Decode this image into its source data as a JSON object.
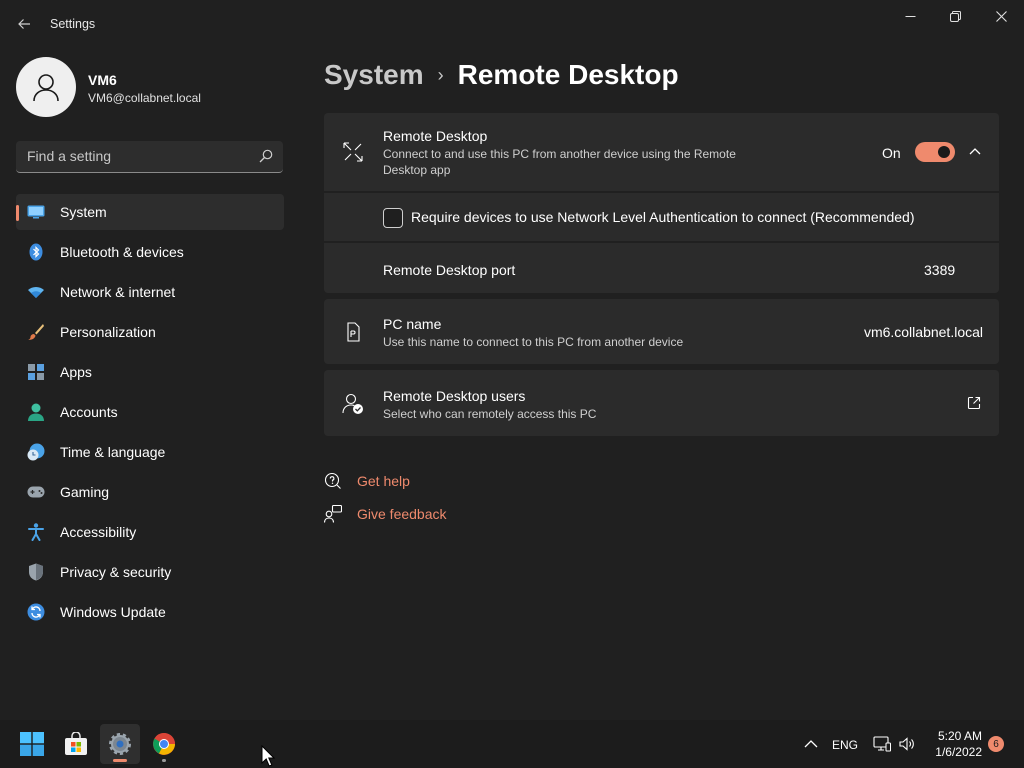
{
  "window": {
    "title": "Settings"
  },
  "user": {
    "name": "VM6",
    "email": "VM6@collabnet.local"
  },
  "search": {
    "placeholder": "Find a setting"
  },
  "nav": {
    "items": [
      {
        "label": "System",
        "icon": "system-icon",
        "active": true
      },
      {
        "label": "Bluetooth & devices",
        "icon": "bluetooth-icon"
      },
      {
        "label": "Network & internet",
        "icon": "wifi-icon"
      },
      {
        "label": "Personalization",
        "icon": "brush-icon"
      },
      {
        "label": "Apps",
        "icon": "apps-icon"
      },
      {
        "label": "Accounts",
        "icon": "accounts-icon"
      },
      {
        "label": "Time & language",
        "icon": "clock-globe-icon"
      },
      {
        "label": "Gaming",
        "icon": "gamepad-icon"
      },
      {
        "label": "Accessibility",
        "icon": "accessibility-icon"
      },
      {
        "label": "Privacy & security",
        "icon": "shield-icon"
      },
      {
        "label": "Windows Update",
        "icon": "update-icon"
      }
    ]
  },
  "breadcrumb": {
    "parent": "System",
    "current": "Remote Desktop"
  },
  "remote_desktop": {
    "title": "Remote Desktop",
    "description_line1": "Connect to and use this PC from another device using the Remote",
    "description_line2": "Desktop app",
    "toggle_label": "On",
    "toggle_on": true,
    "expanded": true
  },
  "nla": {
    "label": "Require devices to use Network Level Authentication to connect (Recommended)",
    "checked": false
  },
  "port": {
    "label": "Remote Desktop port",
    "value": "3389"
  },
  "pc_name": {
    "title": "PC name",
    "description": "Use this name to connect to this PC from another device",
    "value": "vm6.collabnet.local"
  },
  "rd_users": {
    "title": "Remote Desktop users",
    "description": "Select who can remotely access this PC"
  },
  "help": {
    "get_help": "Get help",
    "give_feedback": "Give feedback"
  },
  "taskbar": {
    "apps": [
      "start-icon",
      "store-icon",
      "settings-icon",
      "chrome-icon"
    ],
    "language": "ENG",
    "time": "5:20 AM",
    "date": "1/6/2022",
    "notifications": "6"
  },
  "colors": {
    "accent": "#ef8a6d",
    "background": "#202020",
    "card": "#2b2b2b"
  }
}
